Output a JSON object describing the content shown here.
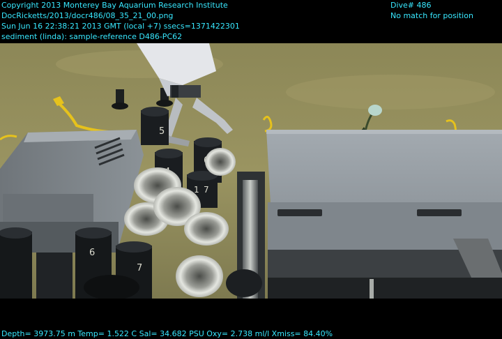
{
  "overlay": {
    "top_left": [
      "Copyright 2013 Monterey Bay Aquarium Research Institute",
      "DocRicketts/2013/docr486/08_35_21_00.png",
      "Sun Jun 16 22:38:21 2013 GMT (local +7)  ssecs=1371422301",
      "sediment (linda): sample-reference D486-PC62"
    ],
    "top_right": [
      "Dive# 486",
      "No match for position"
    ],
    "bottom": "Depth= 3973.75 m  Temp= 1.522 C  Sal= 34.682 PSU  Oxy= 2.738 ml/l  Xmiss= 84.40%"
  },
  "scene": {
    "push_core_labels": [
      "5",
      "4",
      "6",
      "1",
      "7",
      "6",
      "7"
    ],
    "colors": {
      "sediment": "#9a9360",
      "equipment_gray": "#8f969c",
      "overlay_text": "#38e8ff",
      "tag_yellow": "#e6c21c"
    }
  }
}
